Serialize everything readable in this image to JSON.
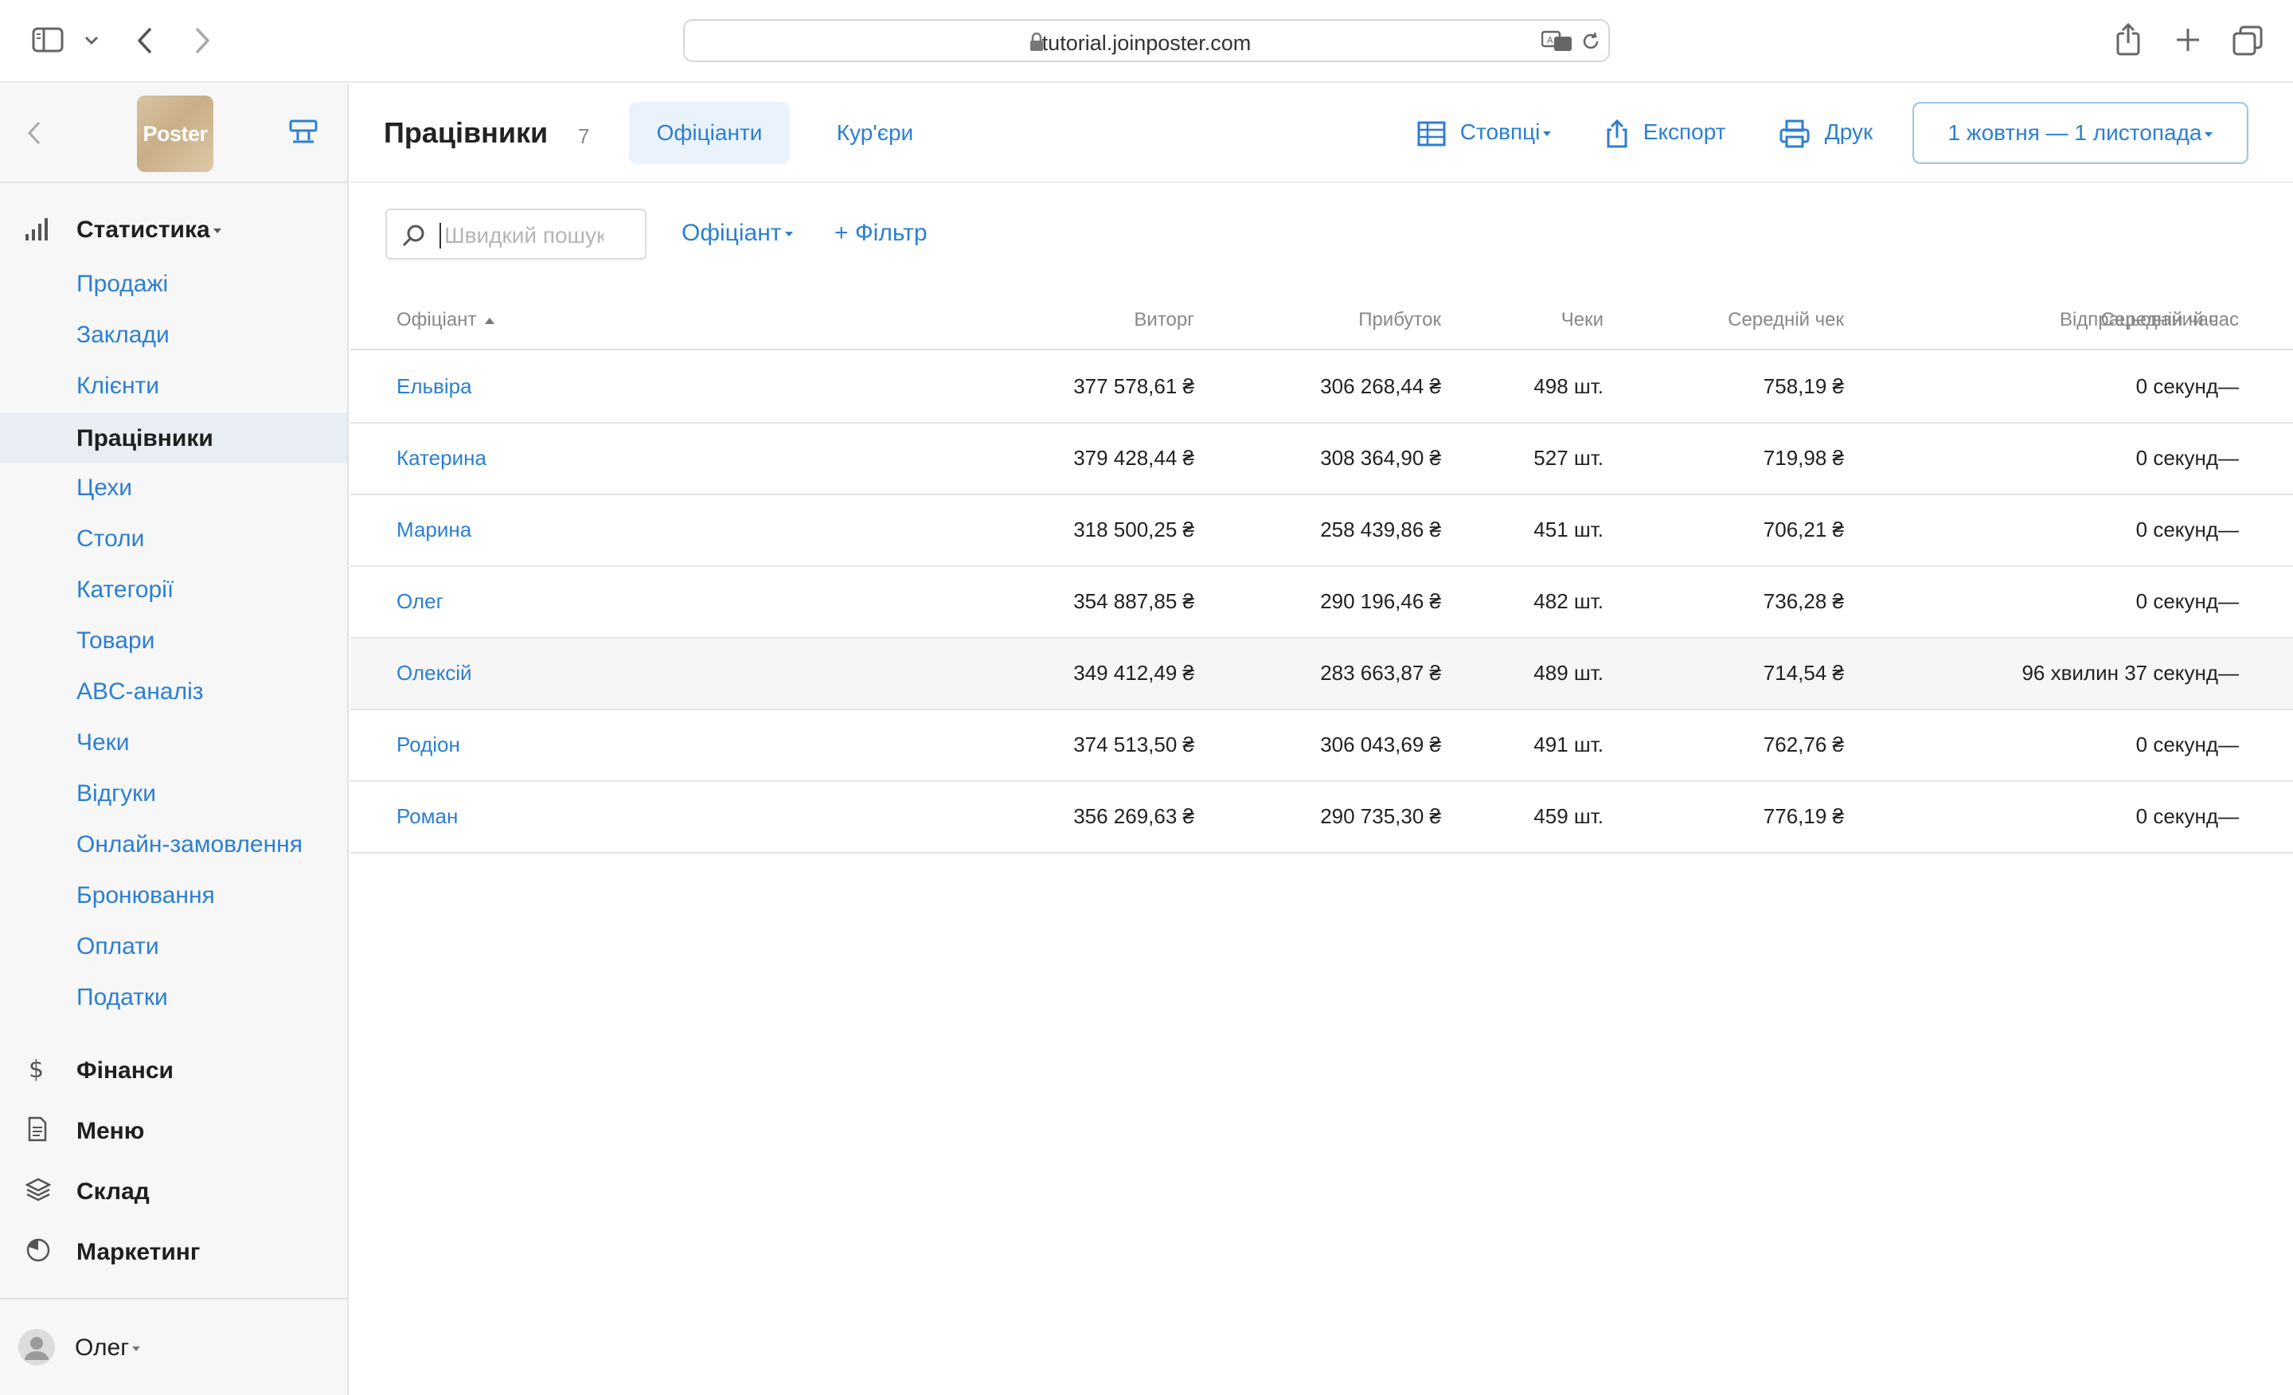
{
  "browser": {
    "url": "tutorial.joinposter.com"
  },
  "sidebar": {
    "logo_text": "Poster",
    "sections": {
      "statistics": "Статистика",
      "finance": "Фінанси",
      "menu": "Меню",
      "warehouse": "Склад",
      "marketing": "Маркетинг"
    },
    "items": [
      "Продажі",
      "Заклади",
      "Клієнти",
      "Працівники",
      "Цехи",
      "Столи",
      "Категорії",
      "Товари",
      "ABC-аналіз",
      "Чеки",
      "Відгуки",
      "Онлайн-замовлення",
      "Бронювання",
      "Оплати",
      "Податки"
    ],
    "active_item": "Працівники",
    "user": "Олег"
  },
  "header": {
    "title": "Працівники",
    "count": "7",
    "tabs": [
      "Офіціанти",
      "Кур'єри"
    ],
    "active_tab": "Офіціанти",
    "columns_label": "Стовпці",
    "export_label": "Експорт",
    "print_label": "Друк",
    "date_range": "1 жовтня — 1 листопада"
  },
  "filters": {
    "search_placeholder": "Швидкий пошук",
    "waiter_filter": "Офіціант",
    "add_filter": "+ Фільтр"
  },
  "table": {
    "headers": [
      "Офіціант",
      "Виторг",
      "Прибуток",
      "Чеки",
      "Середній чек",
      "Середній час",
      "Відпрацьований час"
    ],
    "rows": [
      [
        "Ельвіра",
        "377 578,61 ₴",
        "306 268,44 ₴",
        "498 шт.",
        "758,19 ₴",
        "0 секунд",
        "—"
      ],
      [
        "Катерина",
        "379 428,44 ₴",
        "308 364,90 ₴",
        "527 шт.",
        "719,98 ₴",
        "0 секунд",
        "—"
      ],
      [
        "Марина",
        "318 500,25 ₴",
        "258 439,86 ₴",
        "451 шт.",
        "706,21 ₴",
        "0 секунд",
        "—"
      ],
      [
        "Олег",
        "354 887,85 ₴",
        "290 196,46 ₴",
        "482 шт.",
        "736,28 ₴",
        "0 секунд",
        "—"
      ],
      [
        "Олексій",
        "349 412,49 ₴",
        "283 663,87 ₴",
        "489 шт.",
        "714,54 ₴",
        "96 хвилин 37 секунд",
        "—"
      ],
      [
        "Родіон",
        "374 513,50 ₴",
        "306 043,69 ₴",
        "491 шт.",
        "762,76 ₴",
        "0 секунд",
        "—"
      ],
      [
        "Роман",
        "356 269,63 ₴",
        "290 735,30 ₴",
        "459 шт.",
        "776,19 ₴",
        "0 секунд",
        "—"
      ]
    ],
    "highlighted_row": "Олексій"
  },
  "colors": {
    "accent": "#2c7fd1",
    "active_tab_bg": "#eaf2fb",
    "sidebar_bg": "#f7f7f7",
    "sidebar_active_bg": "#e9eef5",
    "row_highlight": "#f6f6f6"
  },
  "icons": [
    "sidebar-toggle-icon",
    "chevron-down-icon",
    "back-arrow-icon",
    "forward-arrow-icon",
    "lock-icon",
    "translate-icon",
    "reload-icon",
    "share-icon",
    "new-tab-icon",
    "tabs-overview-icon",
    "collapse-arrow-icon",
    "register-icon",
    "bar-chart-icon",
    "dollar-icon",
    "document-icon",
    "layers-icon",
    "pie-icon",
    "user-avatar-icon",
    "table-columns-icon",
    "export-icon",
    "print-icon",
    "search-icon"
  ]
}
